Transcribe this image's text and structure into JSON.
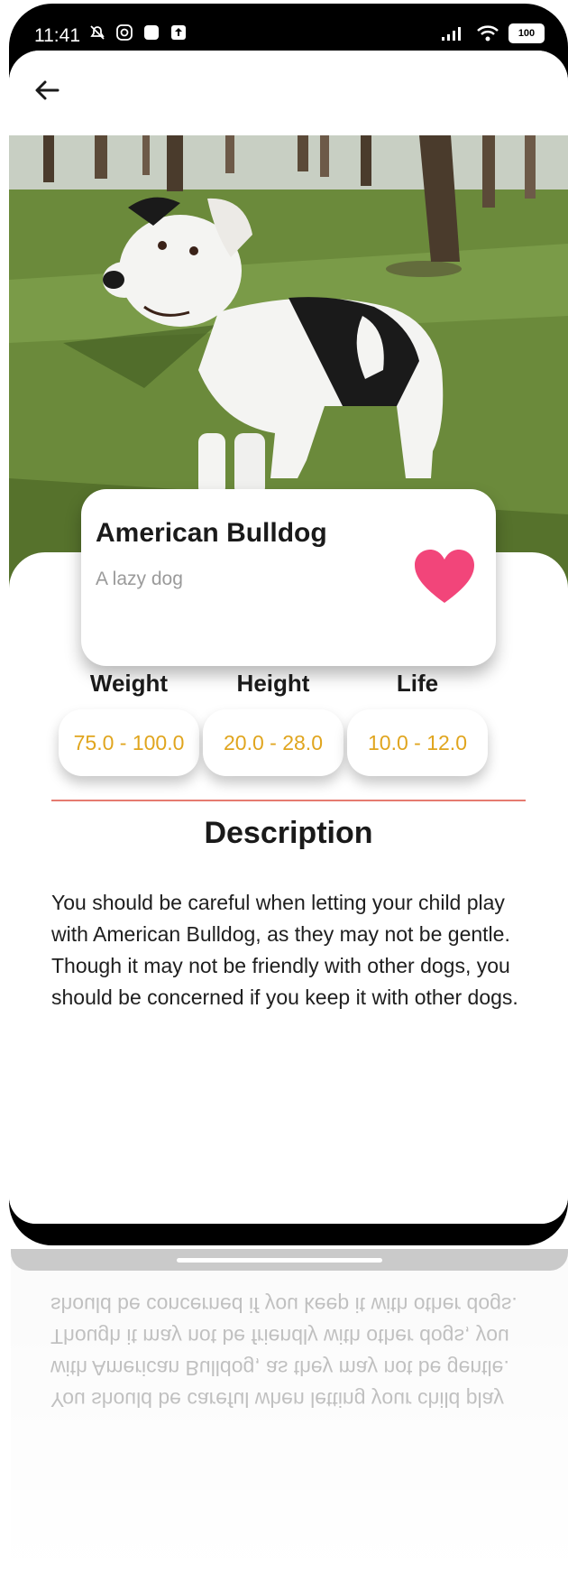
{
  "status": {
    "time": "11:41",
    "battery": "100"
  },
  "breed": {
    "name": "American Bulldog",
    "tagline": "A lazy dog"
  },
  "stats": [
    {
      "label": "Weight",
      "value": "75.0 - 100.0"
    },
    {
      "label": "Height",
      "value": "20.0 - 28.0"
    },
    {
      "label": "Life",
      "value": "10.0 - 12.0"
    }
  ],
  "description": {
    "title": "Description",
    "paragraph1": "You should be careful when letting your child play with American Bulldog, as they may not be gentle.",
    "paragraph2": "Though it may not be friendly with other dogs, you should be concerned if you keep it with other dogs."
  },
  "icons": {
    "back": "arrow-left",
    "favorite": "heart",
    "status_left": [
      "mute-bell",
      "instagram",
      "square-app",
      "upload-box"
    ],
    "status_right": [
      "signal",
      "wifi",
      "battery"
    ]
  },
  "colors": {
    "heart": "#f2457a",
    "stat_value": "#e0a51e",
    "divider": "#e57b70",
    "tagline": "#9a9a9a"
  }
}
